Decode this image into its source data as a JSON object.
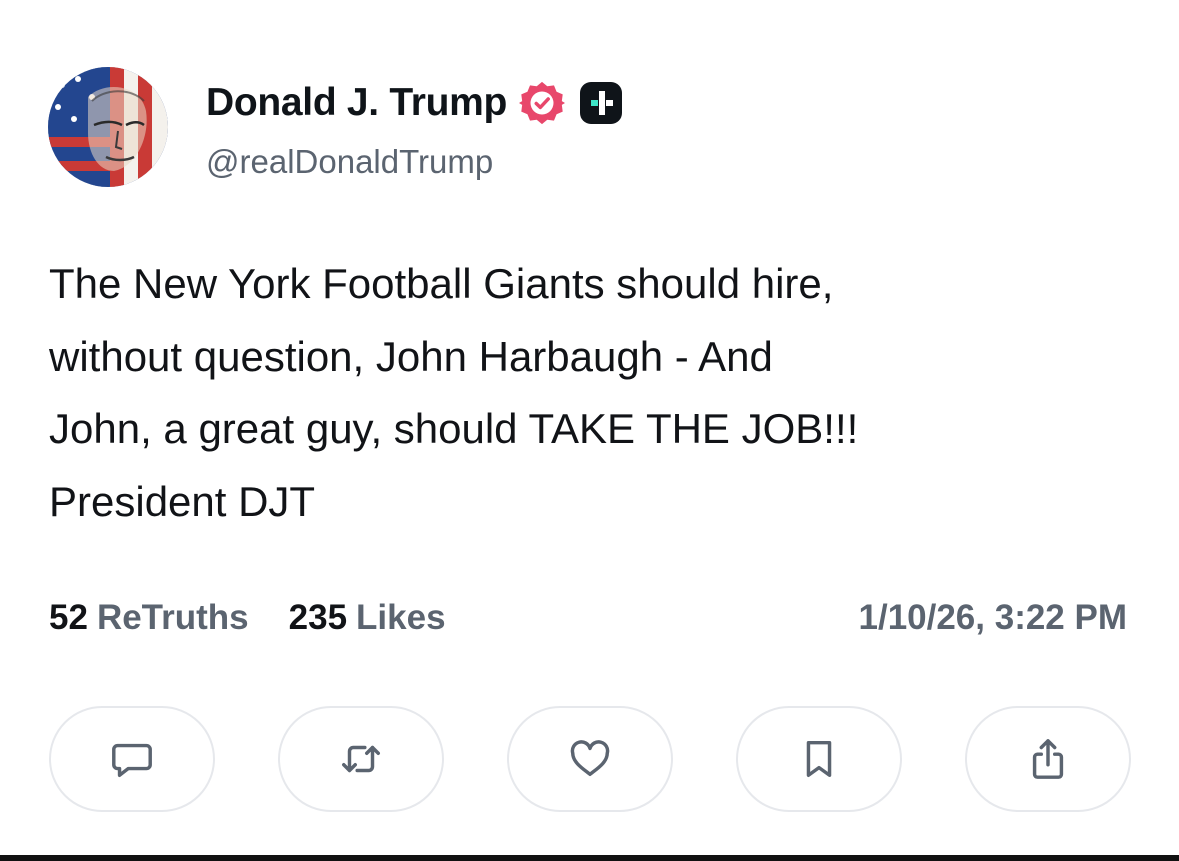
{
  "author": {
    "display_name": "Donald J. Trump",
    "handle": "@realDonaldTrump",
    "verified_badge_color": "#e8476b",
    "plus_badge_color": "#0f1419",
    "plus_badge_accent": "#3ee6c8"
  },
  "post": {
    "text": "The New York Football Giants should hire,\nwithout question, John Harbaugh - And\nJohn, a great guy, should TAKE THE JOB!!!\nPresident DJT"
  },
  "stats": {
    "retruths_count": "52",
    "retruths_label": "ReTruths",
    "likes_count": "235",
    "likes_label": "Likes",
    "timestamp": "1/10/26, 3:22 PM"
  },
  "actions": [
    {
      "icon": "reply-icon"
    },
    {
      "icon": "retruth-icon"
    },
    {
      "icon": "like-icon"
    },
    {
      "icon": "bookmark-icon"
    },
    {
      "icon": "share-icon"
    }
  ],
  "colors": {
    "text_primary": "#111317",
    "text_secondary": "#5b6470",
    "button_border": "#e6e8ec",
    "icon_color": "#5b6470"
  }
}
